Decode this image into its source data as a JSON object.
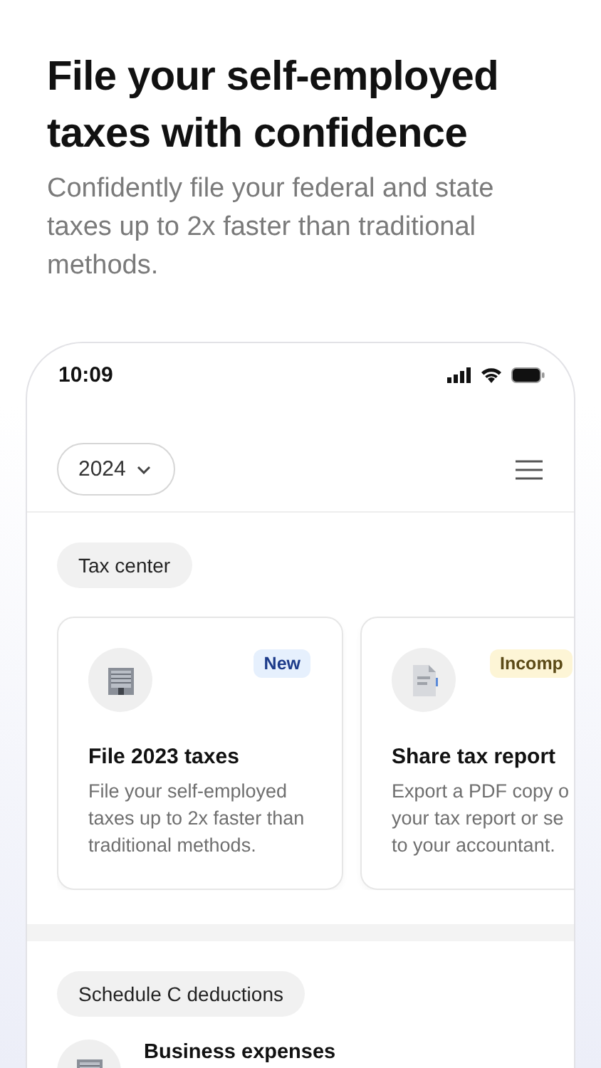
{
  "hero": {
    "title": "File your self-employed taxes with confidence",
    "subtitle": "Confidently file your federal and state taxes up to 2x faster than traditional methods."
  },
  "phone": {
    "status_bar": {
      "time": "10:09"
    },
    "header": {
      "year": "2024"
    },
    "tax_center": {
      "label": "Tax center",
      "cards": [
        {
          "kind": "building",
          "title": "File 2023 taxes",
          "description": "File your self-employed taxes up to 2x faster than traditional methods.",
          "badge": {
            "text": "New",
            "kind": "new"
          }
        },
        {
          "kind": "document",
          "title": "Share tax report",
          "description": "Export a PDF copy o\nyour tax report or se\nto your accountant.",
          "badge": {
            "text": "Incomp",
            "kind": "warning"
          }
        }
      ]
    },
    "deductions": {
      "label": "Schedule C deductions",
      "rows": [
        {
          "kind": "building",
          "title": "Business expenses"
        }
      ]
    }
  }
}
